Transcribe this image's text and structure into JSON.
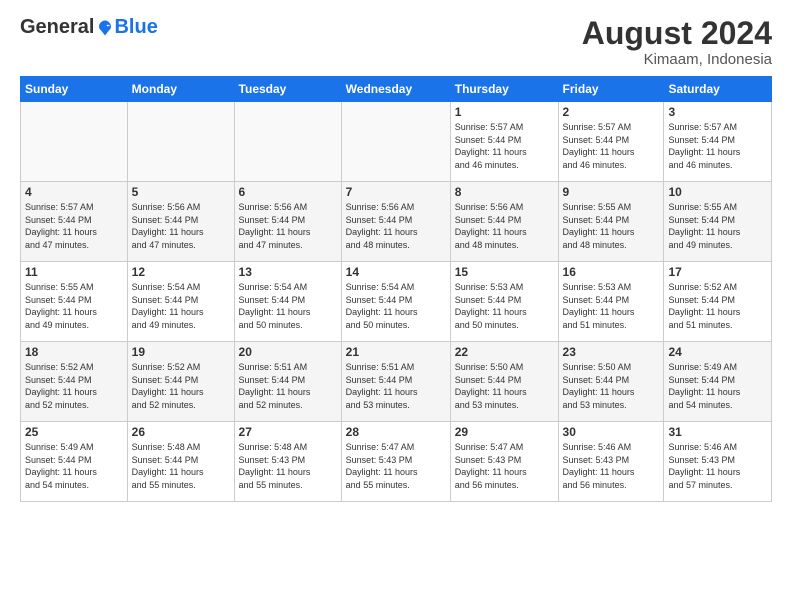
{
  "logo": {
    "general": "General",
    "blue": "Blue"
  },
  "title": {
    "month_year": "August 2024",
    "location": "Kimaam, Indonesia"
  },
  "weekdays": [
    "Sunday",
    "Monday",
    "Tuesday",
    "Wednesday",
    "Thursday",
    "Friday",
    "Saturday"
  ],
  "weeks": [
    [
      {
        "day": "",
        "info": ""
      },
      {
        "day": "",
        "info": ""
      },
      {
        "day": "",
        "info": ""
      },
      {
        "day": "",
        "info": ""
      },
      {
        "day": "1",
        "info": "Sunrise: 5:57 AM\nSunset: 5:44 PM\nDaylight: 11 hours\nand 46 minutes."
      },
      {
        "day": "2",
        "info": "Sunrise: 5:57 AM\nSunset: 5:44 PM\nDaylight: 11 hours\nand 46 minutes."
      },
      {
        "day": "3",
        "info": "Sunrise: 5:57 AM\nSunset: 5:44 PM\nDaylight: 11 hours\nand 46 minutes."
      }
    ],
    [
      {
        "day": "4",
        "info": "Sunrise: 5:57 AM\nSunset: 5:44 PM\nDaylight: 11 hours\nand 47 minutes."
      },
      {
        "day": "5",
        "info": "Sunrise: 5:56 AM\nSunset: 5:44 PM\nDaylight: 11 hours\nand 47 minutes."
      },
      {
        "day": "6",
        "info": "Sunrise: 5:56 AM\nSunset: 5:44 PM\nDaylight: 11 hours\nand 47 minutes."
      },
      {
        "day": "7",
        "info": "Sunrise: 5:56 AM\nSunset: 5:44 PM\nDaylight: 11 hours\nand 48 minutes."
      },
      {
        "day": "8",
        "info": "Sunrise: 5:56 AM\nSunset: 5:44 PM\nDaylight: 11 hours\nand 48 minutes."
      },
      {
        "day": "9",
        "info": "Sunrise: 5:55 AM\nSunset: 5:44 PM\nDaylight: 11 hours\nand 48 minutes."
      },
      {
        "day": "10",
        "info": "Sunrise: 5:55 AM\nSunset: 5:44 PM\nDaylight: 11 hours\nand 49 minutes."
      }
    ],
    [
      {
        "day": "11",
        "info": "Sunrise: 5:55 AM\nSunset: 5:44 PM\nDaylight: 11 hours\nand 49 minutes."
      },
      {
        "day": "12",
        "info": "Sunrise: 5:54 AM\nSunset: 5:44 PM\nDaylight: 11 hours\nand 49 minutes."
      },
      {
        "day": "13",
        "info": "Sunrise: 5:54 AM\nSunset: 5:44 PM\nDaylight: 11 hours\nand 50 minutes."
      },
      {
        "day": "14",
        "info": "Sunrise: 5:54 AM\nSunset: 5:44 PM\nDaylight: 11 hours\nand 50 minutes."
      },
      {
        "day": "15",
        "info": "Sunrise: 5:53 AM\nSunset: 5:44 PM\nDaylight: 11 hours\nand 50 minutes."
      },
      {
        "day": "16",
        "info": "Sunrise: 5:53 AM\nSunset: 5:44 PM\nDaylight: 11 hours\nand 51 minutes."
      },
      {
        "day": "17",
        "info": "Sunrise: 5:52 AM\nSunset: 5:44 PM\nDaylight: 11 hours\nand 51 minutes."
      }
    ],
    [
      {
        "day": "18",
        "info": "Sunrise: 5:52 AM\nSunset: 5:44 PM\nDaylight: 11 hours\nand 52 minutes."
      },
      {
        "day": "19",
        "info": "Sunrise: 5:52 AM\nSunset: 5:44 PM\nDaylight: 11 hours\nand 52 minutes."
      },
      {
        "day": "20",
        "info": "Sunrise: 5:51 AM\nSunset: 5:44 PM\nDaylight: 11 hours\nand 52 minutes."
      },
      {
        "day": "21",
        "info": "Sunrise: 5:51 AM\nSunset: 5:44 PM\nDaylight: 11 hours\nand 53 minutes."
      },
      {
        "day": "22",
        "info": "Sunrise: 5:50 AM\nSunset: 5:44 PM\nDaylight: 11 hours\nand 53 minutes."
      },
      {
        "day": "23",
        "info": "Sunrise: 5:50 AM\nSunset: 5:44 PM\nDaylight: 11 hours\nand 53 minutes."
      },
      {
        "day": "24",
        "info": "Sunrise: 5:49 AM\nSunset: 5:44 PM\nDaylight: 11 hours\nand 54 minutes."
      }
    ],
    [
      {
        "day": "25",
        "info": "Sunrise: 5:49 AM\nSunset: 5:44 PM\nDaylight: 11 hours\nand 54 minutes."
      },
      {
        "day": "26",
        "info": "Sunrise: 5:48 AM\nSunset: 5:44 PM\nDaylight: 11 hours\nand 55 minutes."
      },
      {
        "day": "27",
        "info": "Sunrise: 5:48 AM\nSunset: 5:43 PM\nDaylight: 11 hours\nand 55 minutes."
      },
      {
        "day": "28",
        "info": "Sunrise: 5:47 AM\nSunset: 5:43 PM\nDaylight: 11 hours\nand 55 minutes."
      },
      {
        "day": "29",
        "info": "Sunrise: 5:47 AM\nSunset: 5:43 PM\nDaylight: 11 hours\nand 56 minutes."
      },
      {
        "day": "30",
        "info": "Sunrise: 5:46 AM\nSunset: 5:43 PM\nDaylight: 11 hours\nand 56 minutes."
      },
      {
        "day": "31",
        "info": "Sunrise: 5:46 AM\nSunset: 5:43 PM\nDaylight: 11 hours\nand 57 minutes."
      }
    ]
  ]
}
